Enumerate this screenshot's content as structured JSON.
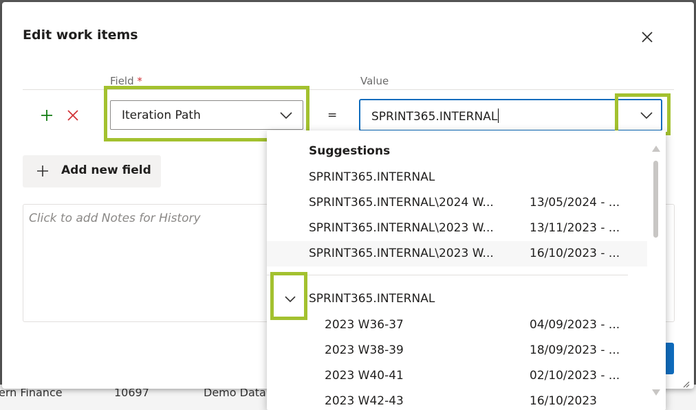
{
  "background_row": {
    "cells": [
      "ern Finance",
      "10697",
      "Demo Data"
    ]
  },
  "dialog": {
    "title": "Edit work items",
    "field_label": "Field",
    "required_mark": "*",
    "value_label": "Value",
    "field_value": "Iteration Path",
    "equals": "=",
    "value_text": "SPRINT365.INTERNAL",
    "add_field_label": "Add new field",
    "notes_placeholder": "Click to add Notes for History"
  },
  "dropdown": {
    "heading": "Suggestions",
    "suggestions": [
      {
        "name": "SPRINT365.INTERNAL",
        "date": ""
      },
      {
        "name": "SPRINT365.INTERNAL\\2024 W...",
        "date": "13/05/2024 - ..."
      },
      {
        "name": "SPRINT365.INTERNAL\\2023 W...",
        "date": "13/11/2023 - ..."
      },
      {
        "name": "SPRINT365.INTERNAL\\2023 W...",
        "date": "16/10/2023 - ..."
      }
    ],
    "tree_root": "SPRINT365.INTERNAL",
    "children": [
      {
        "name": "2023 W36-37",
        "date": "04/09/2023 - ..."
      },
      {
        "name": "2023 W38-39",
        "date": "18/09/2023 - ..."
      },
      {
        "name": "2023 W40-41",
        "date": "02/10/2023 - ..."
      },
      {
        "name": "2023 W42-43",
        "date": "16/10/2023"
      }
    ]
  },
  "colors": {
    "accent": "#0f6cbd",
    "highlight": "#a3c12f",
    "add_icon": "#107c10",
    "remove_icon": "#d13438"
  },
  "icons": [
    "close-icon",
    "plus-icon",
    "remove-icon",
    "chevron-down-icon",
    "scroll-up-icon",
    "scroll-down-icon",
    "resize-grip-icon"
  ]
}
